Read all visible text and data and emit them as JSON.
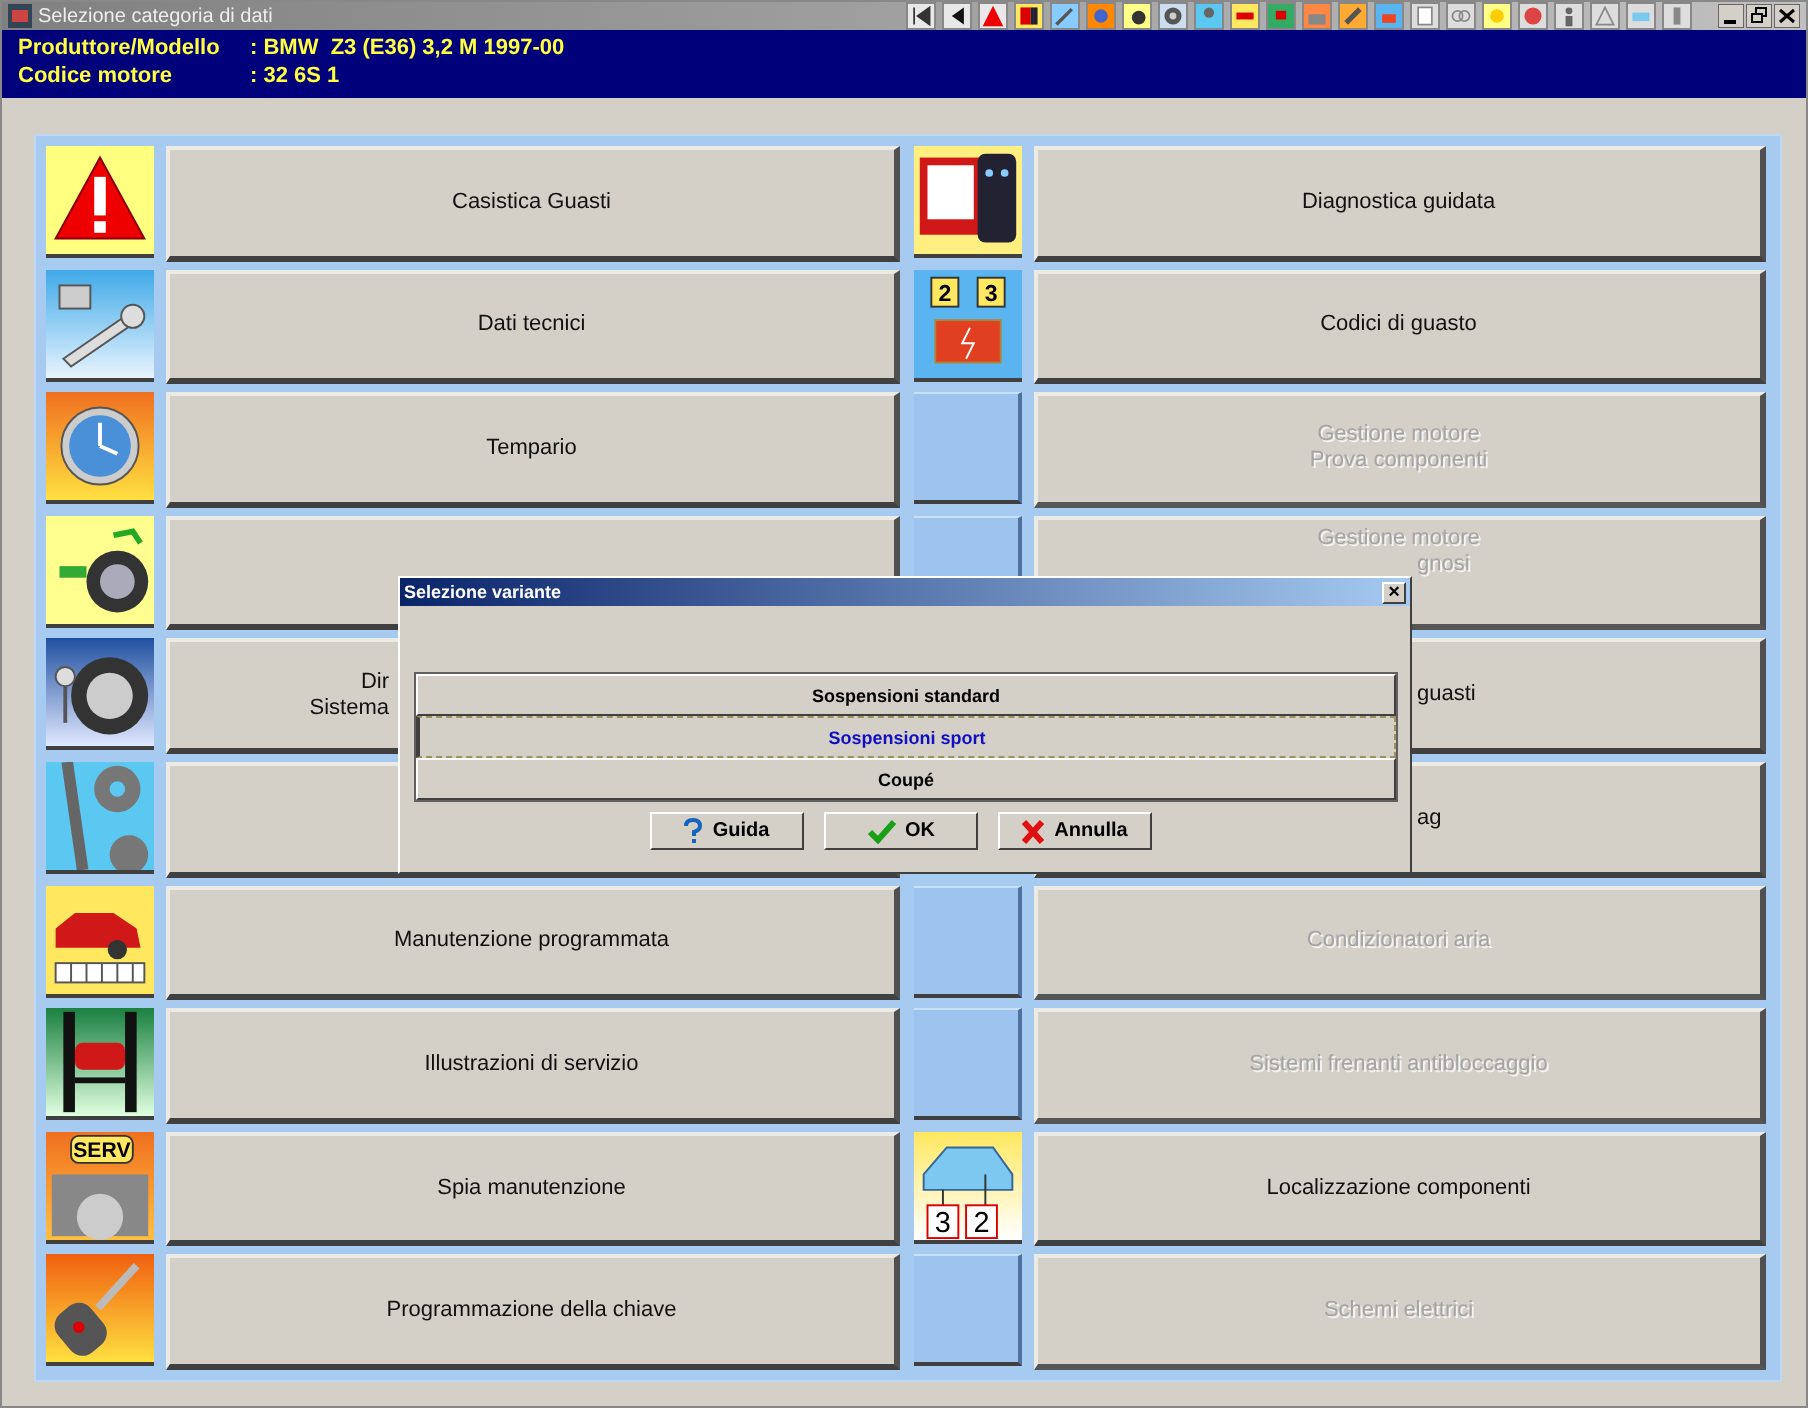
{
  "window": {
    "title": "Selezione categoria di dati"
  },
  "header": [
    {
      "label": "Produttore/Modello",
      "value": ": BMW  Z3 (E36) 3,2 M 1997-00"
    },
    {
      "label": "Codice motore",
      "value": ": 32 6S 1"
    }
  ],
  "categories_left": [
    {
      "lines": [
        "Casistica Guasti"
      ],
      "disabled": false
    },
    {
      "lines": [
        "Dati tecnici"
      ],
      "disabled": false
    },
    {
      "lines": [
        "Tempario"
      ],
      "disabled": false
    },
    {
      "disabled": false
    },
    {
      "lines": [
        "Dir",
        "Sistema"
      ],
      "disabled": false
    },
    {
      "disabled": false
    },
    {
      "lines": [
        "Manutenzione programmata"
      ],
      "disabled": false
    },
    {
      "lines": [
        "Illustrazioni di servizio"
      ],
      "disabled": false
    },
    {
      "lines": [
        "Spia manutenzione"
      ],
      "disabled": false,
      "icon_texts": [
        "SERV"
      ]
    },
    {
      "lines": [
        "Programmazione della chiave"
      ],
      "disabled": false
    }
  ],
  "categories_right": [
    {
      "lines": [
        "Diagnostica guidata"
      ],
      "disabled": false
    },
    {
      "lines": [
        "Codici di guasto"
      ],
      "disabled": false,
      "icon_texts": [
        "2",
        "3"
      ]
    },
    {
      "lines": [
        "Gestione motore",
        "Prova componenti"
      ],
      "disabled": true
    },
    {
      "lines": [
        "Gestione motore",
        "gnosi"
      ],
      "disabled": true
    },
    {
      "lines": [
        "guasti"
      ],
      "disabled": false
    },
    {
      "lines": [
        "ag"
      ],
      "disabled": false
    },
    {
      "lines": [
        "Condizionatori aria"
      ],
      "disabled": true
    },
    {
      "lines": [
        "Sistemi frenanti antibloccaggio"
      ],
      "disabled": true
    },
    {
      "lines": [
        "Localizzazione componenti"
      ],
      "disabled": false,
      "icon_texts": [
        "3",
        "2"
      ]
    },
    {
      "lines": [
        "Schemi elettrici"
      ],
      "disabled": true
    }
  ],
  "dialog": {
    "title": "Selezione variante",
    "close": "×",
    "variants": [
      {
        "label": "Sospensioni standard",
        "selected": false
      },
      {
        "label": "Sospensioni sport",
        "selected": true
      },
      {
        "label": "Coupé",
        "selected": false
      }
    ],
    "buttons": [
      {
        "kind": "help",
        "label": "Guida"
      },
      {
        "kind": "ok",
        "label": "OK"
      },
      {
        "kind": "cancel",
        "label": "Annulla"
      }
    ]
  }
}
